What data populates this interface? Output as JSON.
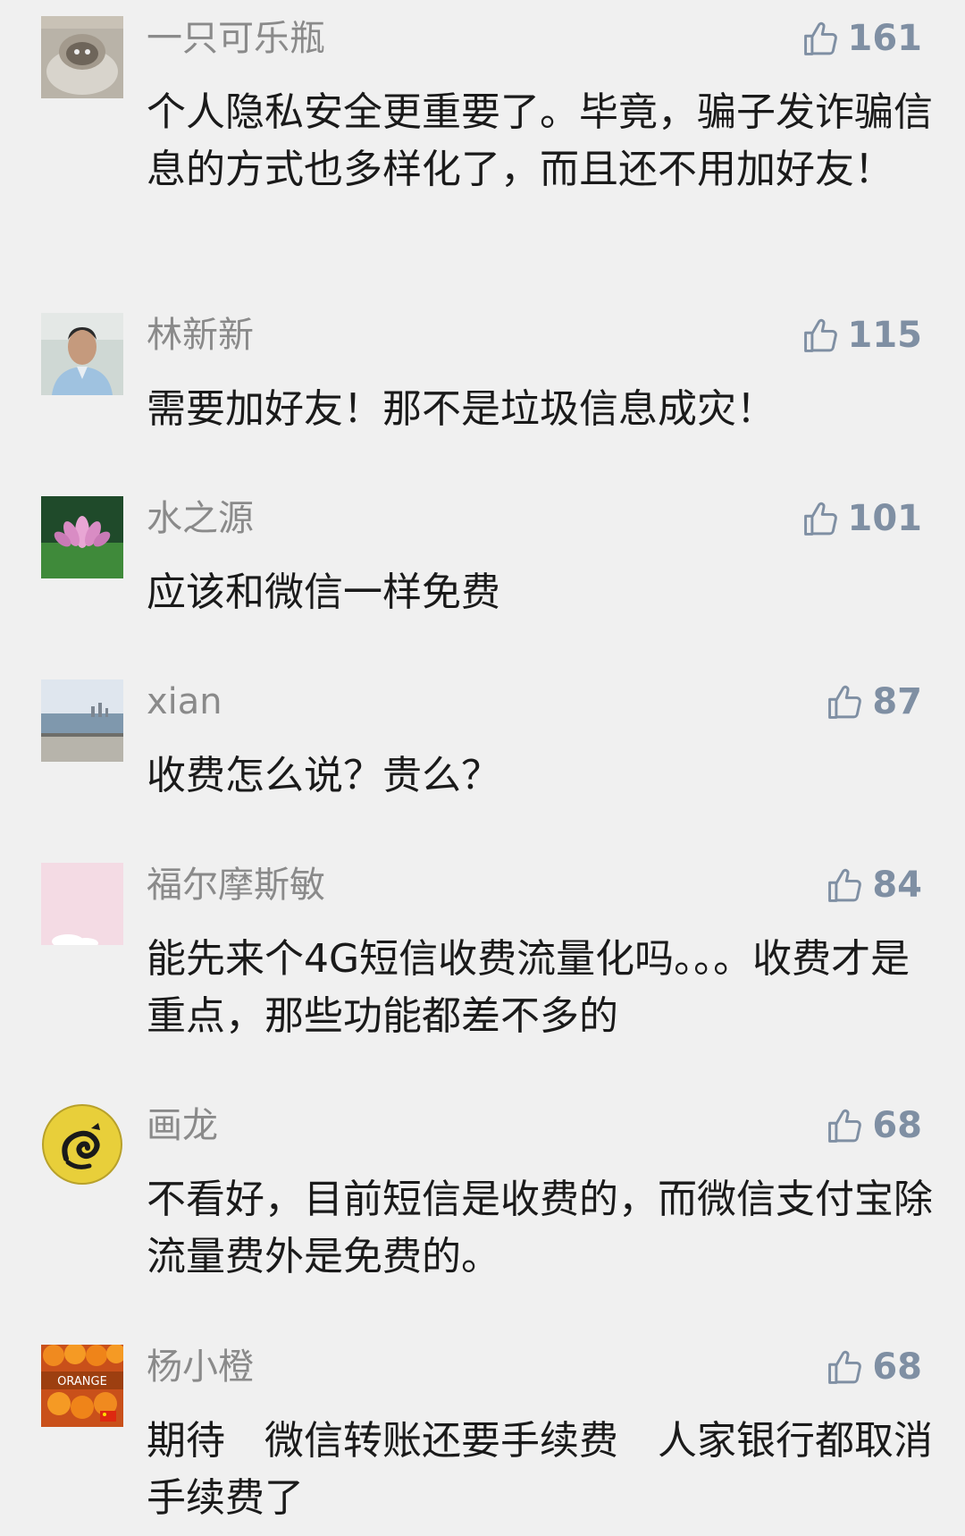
{
  "colors": {
    "background": "#f0f0f0",
    "name": "#8a8a8a",
    "like": "#7f8fa3",
    "text": "#1a1a1a"
  },
  "like_icon": "thumb-up-icon",
  "comments": [
    {
      "avatar": "cat-sculpture-avatar",
      "name": "一只可乐瓶",
      "likes": "161",
      "text": "个人隐私安全更重要了。毕竟，骗子发诈骗信息的方式也多样化了，而且还不用加好友！"
    },
    {
      "avatar": "man-portrait-avatar",
      "name": "林新新",
      "likes": "115",
      "text": "需要加好友！那不是垃圾信息成灾！"
    },
    {
      "avatar": "lotus-flower-avatar",
      "name": "水之源",
      "likes": "101",
      "text": "应该和微信一样免费"
    },
    {
      "avatar": "seaside-avatar",
      "name": "xian",
      "likes": "87",
      "text": "收费怎么说？贵么？"
    },
    {
      "avatar": "pink-cloud-avatar",
      "name": "福尔摩斯敏",
      "likes": "84",
      "text": "能先来个4G短信收费流量化吗。。。收费才是重点，那些功能都差不多的"
    },
    {
      "avatar": "dragon-emblem-avatar",
      "name": "画龙",
      "likes": "68",
      "text": "不看好，目前短信是收费的，而微信支付宝除流量费外是免费的。"
    },
    {
      "avatar": "oranges-avatar",
      "avatar_text": "ORANGE",
      "name": "杨小橙",
      "likes": "68",
      "text": "期待　微信转账还要手续费　人家银行都取消手续费了"
    }
  ]
}
